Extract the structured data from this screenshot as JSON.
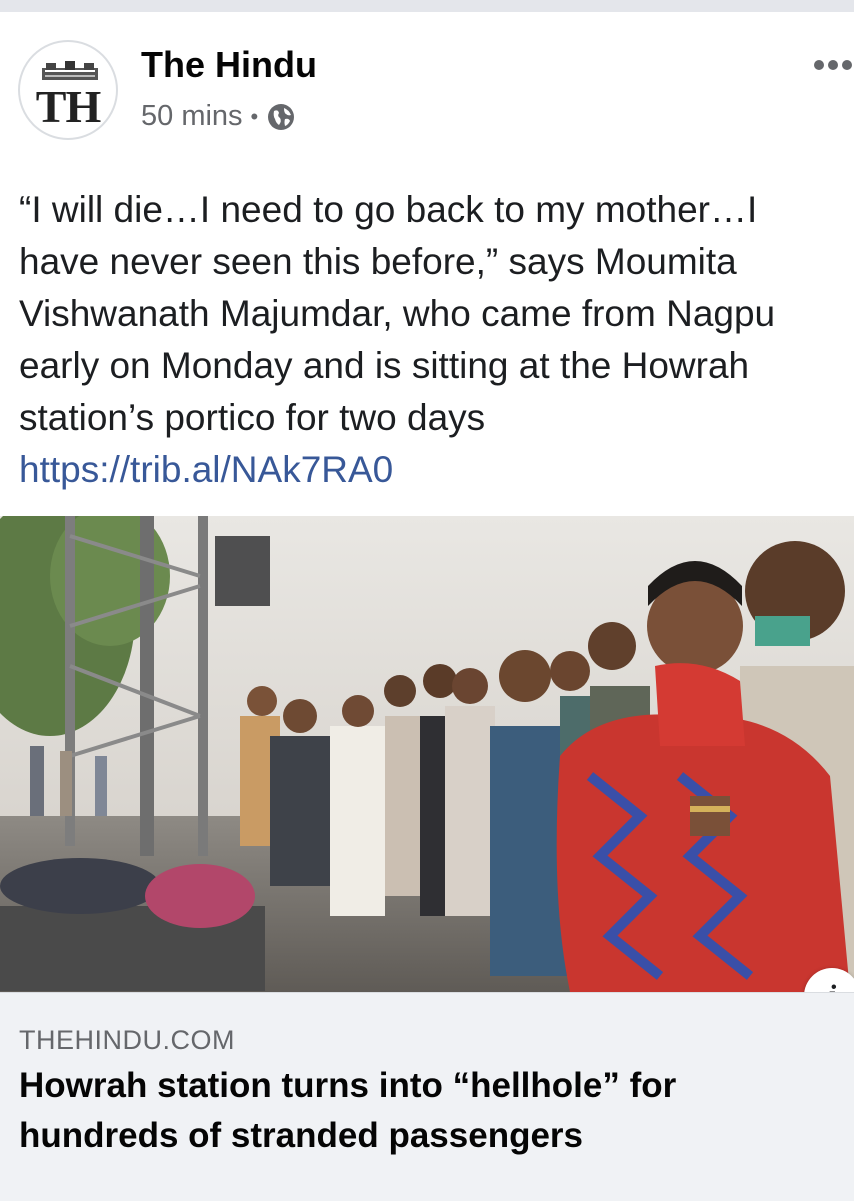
{
  "post": {
    "page_name": "The Hindu",
    "avatar_text": "TH",
    "time": "50 mins",
    "separator": "•",
    "privacy_icon": "globe-icon",
    "more_icon": "more-horizontal-icon",
    "text_lines": [
      "“I will die…I need to go back to my mother…I",
      "have never seen this before,” says Moumita",
      "Vishwanath Majumdar, who came from Nagpu",
      "early on Monday and is sitting at the Howrah",
      "station’s portico for two days"
    ],
    "link": "https://trib.al/NAk7RA0"
  },
  "link_preview": {
    "image_icon": "news-photo",
    "info_icon_label": "i",
    "domain": "THEHINDU.COM",
    "headline": "Howrah station turns into “hellhole” for hundreds of stranded passengers"
  },
  "colors": {
    "link": "#385898",
    "card_bg": "#f0f2f5",
    "meta_text": "#65676b"
  }
}
